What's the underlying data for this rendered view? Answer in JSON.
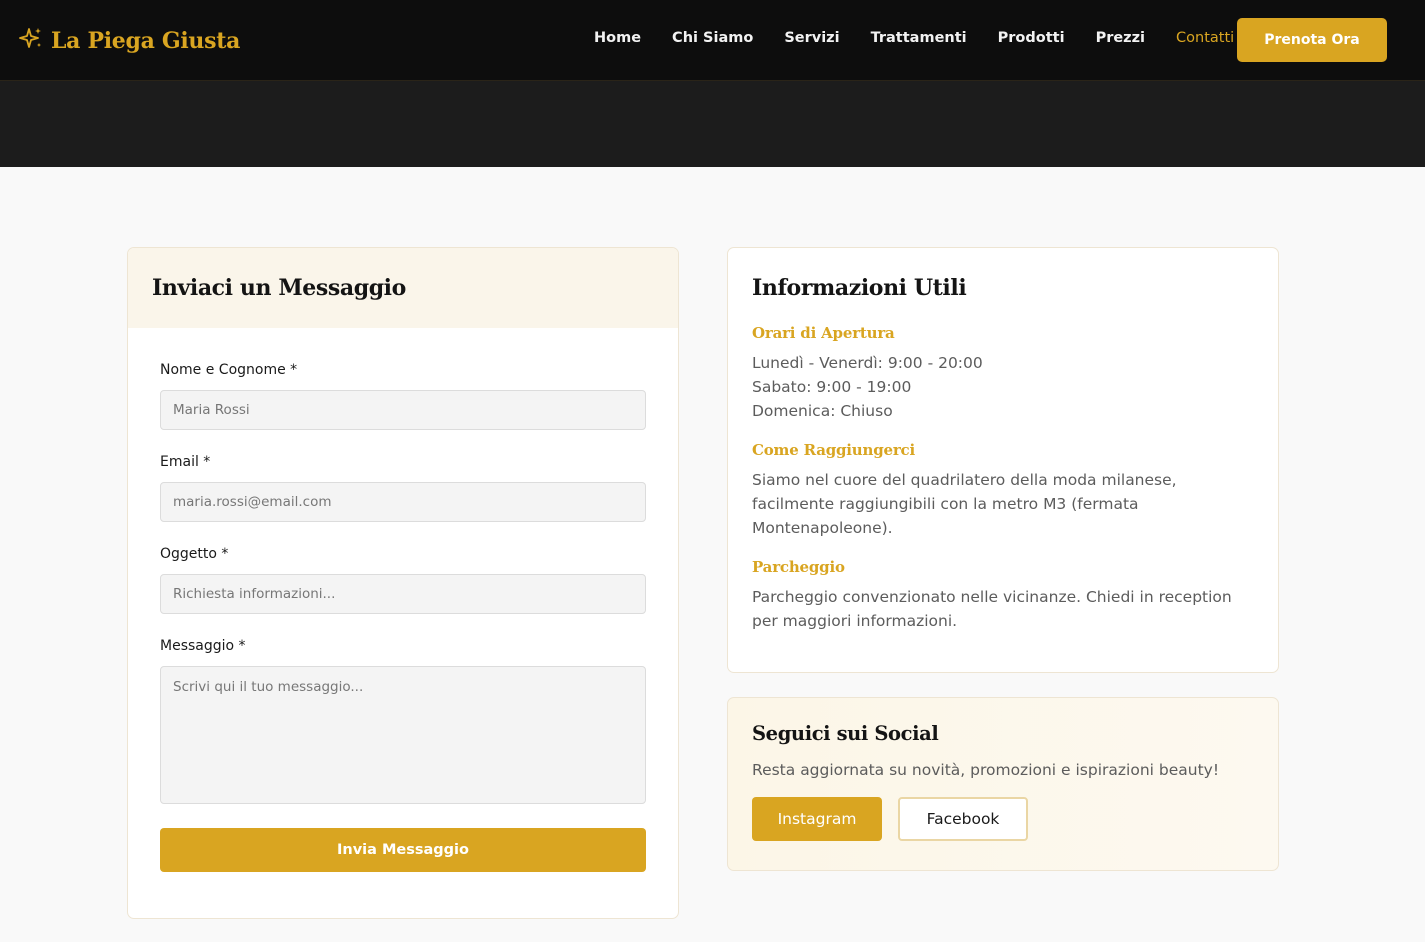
{
  "brand": {
    "name": "La Piega Giusta",
    "icon": "sparkle-icon",
    "color": "#d9a521"
  },
  "nav": {
    "items": [
      {
        "label": "Home",
        "active": false
      },
      {
        "label": "Chi Siamo",
        "active": false
      },
      {
        "label": "Servizi",
        "active": false
      },
      {
        "label": "Trattamenti",
        "active": false
      },
      {
        "label": "Prodotti",
        "active": false
      },
      {
        "label": "Prezzi",
        "active": false
      },
      {
        "label": "Contatti",
        "active": true
      }
    ],
    "cta_label": "Prenota Ora"
  },
  "form": {
    "title": "Inviaci un Messaggio",
    "fields": [
      {
        "label": "Nome e Cognome *",
        "placeholder": "Maria Rossi",
        "value": ""
      },
      {
        "label": "Email *",
        "placeholder": "maria.rossi@email.com",
        "value": ""
      },
      {
        "label": "Oggetto *",
        "placeholder": "Richiesta informazioni...",
        "value": ""
      },
      {
        "label": "Messaggio *",
        "placeholder": "Scrivi qui il tuo messaggio...",
        "value": ""
      }
    ],
    "submit_label": "Invia Messaggio"
  },
  "info": {
    "title": "Informazioni Utili",
    "sections": [
      {
        "title": "Orari di Apertura",
        "lines": [
          "Lunedì - Venerdì: 9:00 - 20:00",
          "Sabato: 9:00 - 19:00",
          "Domenica: Chiuso"
        ]
      },
      {
        "title": "Come Raggiungerci",
        "lines": [
          "Siamo nel cuore del quadrilatero della moda milanese,",
          "facilmente raggiungibili con la metro M3 (fermata",
          "Montenapoleone)."
        ]
      },
      {
        "title": "Parcheggio",
        "lines": [
          "Parcheggio convenzionato nelle vicinanze. Chiedi in reception",
          "per maggiori informazioni."
        ]
      }
    ]
  },
  "social": {
    "title": "Seguici sui Social",
    "text": "Resta aggiornata su novità, promozioni e ispirazioni beauty!",
    "instagram_label": "Instagram",
    "facebook_label": "Facebook"
  }
}
